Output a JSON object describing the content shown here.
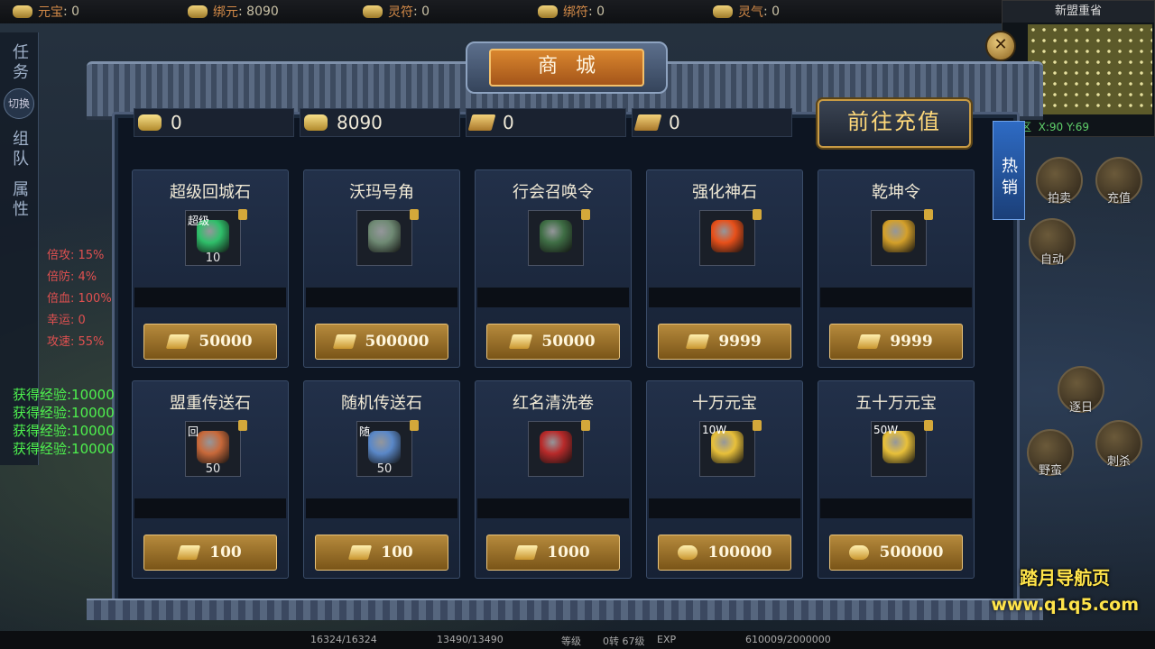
{
  "topbar": {
    "currencies": [
      {
        "label": "元宝",
        "value": "0"
      },
      {
        "label": "绑元",
        "value": "8090"
      },
      {
        "label": "灵符",
        "value": "0"
      },
      {
        "label": "绑符",
        "value": "0"
      },
      {
        "label": "灵气",
        "value": "0"
      }
    ]
  },
  "minimap": {
    "title": "新盟重省",
    "region": "全区",
    "coord": "X:90 Y:69"
  },
  "left_panel": {
    "task_tab": "任务",
    "switch": "切换",
    "team_tab": "组队",
    "attr_tab": "属性"
  },
  "stats": [
    "倍攻: 15%",
    "倍防: 4%",
    "倍血: 100%",
    "幸运: 0",
    "攻速: 55%"
  ],
  "exp_log": [
    "获得经验:10000",
    "获得经验:10000",
    "获得经验:10000",
    "获得经验:10000"
  ],
  "shop": {
    "title": "商城",
    "close": "✕",
    "hot_tab": "热销",
    "balances": [
      "0",
      "8090",
      "0",
      "0"
    ],
    "recharge_button": "前往充值",
    "items": [
      {
        "name": "超级回城石",
        "tag": "超级",
        "count": "10",
        "price": "50000",
        "color": "#2fbf6a"
      },
      {
        "name": "沃玛号角",
        "tag": "",
        "count": "",
        "price": "500000",
        "color": "#6f8a74"
      },
      {
        "name": "行会召唤令",
        "tag": "",
        "count": "",
        "price": "50000",
        "color": "#3f6e45"
      },
      {
        "name": "强化神石",
        "tag": "",
        "count": "",
        "price": "9999",
        "color": "#e8501a"
      },
      {
        "name": "乾坤令",
        "tag": "",
        "count": "",
        "price": "9999",
        "color": "#d4a02a"
      },
      {
        "name": "盟重传送石",
        "tag": "回",
        "count": "50",
        "price": "100",
        "color": "#c8693a"
      },
      {
        "name": "随机传送石",
        "tag": "随",
        "count": "50",
        "price": "100",
        "color": "#5a88c8"
      },
      {
        "name": "红名清洗卷",
        "tag": "",
        "count": "",
        "price": "1000",
        "color": "#b82a2a"
      },
      {
        "name": "十万元宝",
        "tag": "10W",
        "count": "",
        "price": "100000",
        "color": "#e8c03a"
      },
      {
        "name": "五十万元宝",
        "tag": "50W",
        "count": "",
        "price": "500000",
        "color": "#e8c03a"
      }
    ]
  },
  "skills": [
    {
      "label": "拍卖"
    },
    {
      "label": "充值"
    },
    {
      "label": "自动"
    },
    {
      "label": "逐日"
    },
    {
      "label": "野蛮"
    },
    {
      "label": "刺杀"
    }
  ],
  "bottombar": {
    "hp": "16324/16324",
    "mp": "13490/13490",
    "level_label": "等级",
    "level": "0转 67级",
    "exp_label": "EXP",
    "exp": "610009/2000000"
  },
  "watermark": {
    "line1": "踏月导航页",
    "line2": "www.q1q5.com"
  }
}
